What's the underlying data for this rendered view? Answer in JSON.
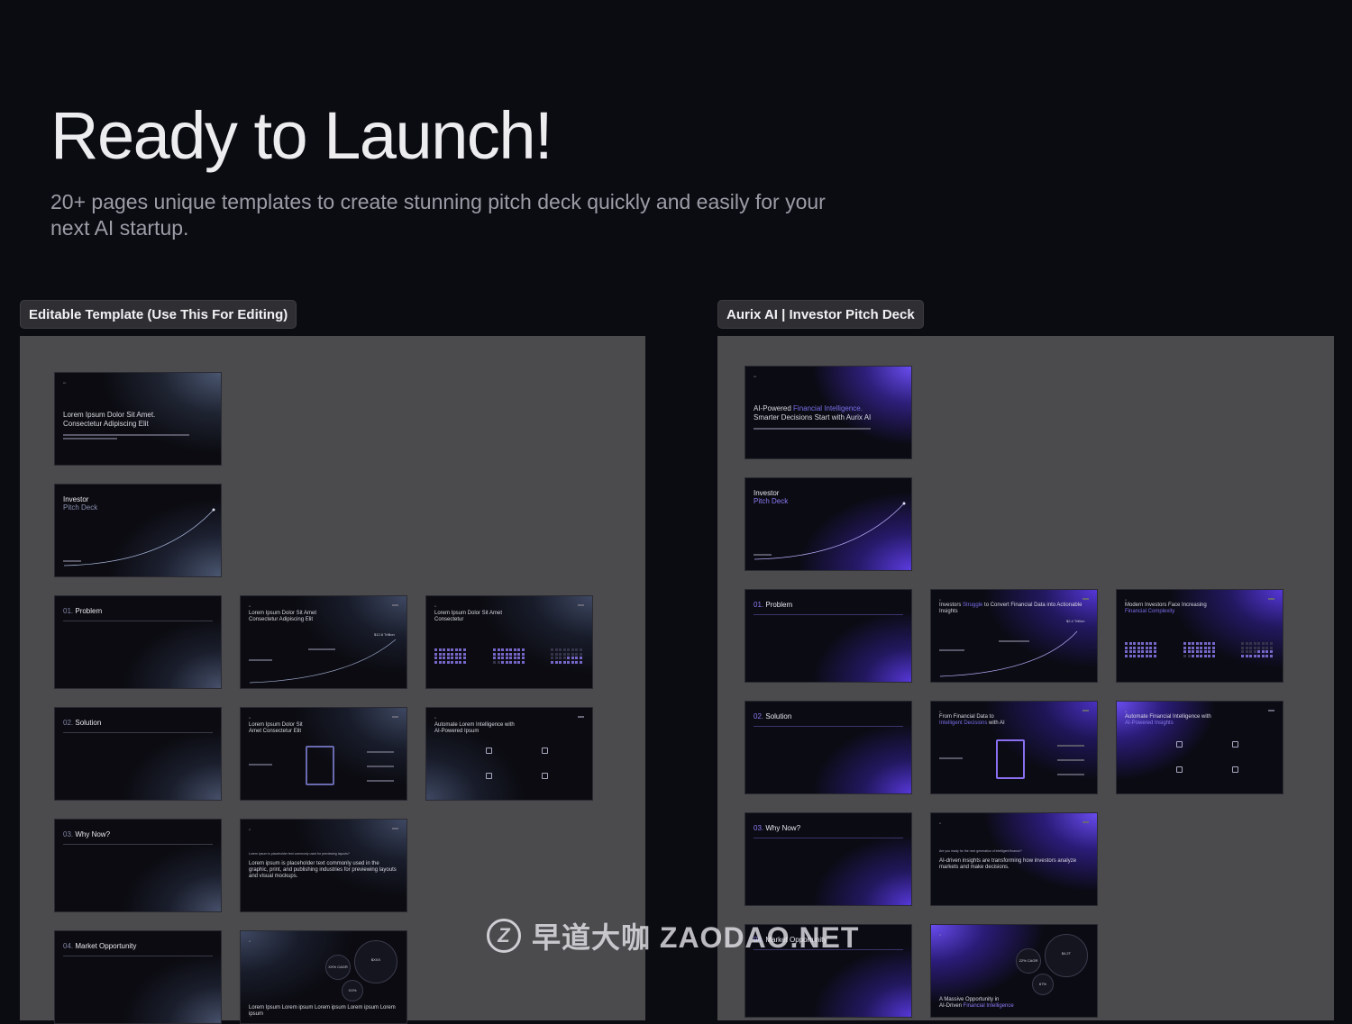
{
  "hero": {
    "title": "Ready to Launch!",
    "subtitle": "20+ pages unique templates to create stunning pitch deck quickly and easily for your next AI startup."
  },
  "frames": {
    "left_label": "Editable Template (Use This For Editing)",
    "right_label": "Aurix AI | Investor Pitch Deck"
  },
  "left": {
    "cover_title_1": "Lorem Ipsum Dolor Sit Amet.",
    "cover_title_2": "Consectetur Adipiscing Elit",
    "investor": "Investor",
    "pitch_deck": "Pitch Deck",
    "problem_num": "01.",
    "problem": "Problem",
    "problem_a_1": "Lorem Ipsum Dolor Sit Amet",
    "problem_a_2": "Consectetur Adipiscing Elit",
    "problem_a_value": "$12.8 Trillion",
    "problem_b_1": "Lorem Ipsum Dolor Sit Amet",
    "problem_b_2": "Consectetur",
    "solution_num": "02.",
    "solution": "Solution",
    "solution_a_1": "Lorem Ipsum Dolor Sit",
    "solution_a_2": "Amet Consectetur Elit",
    "solution_b_1": "Automate Lorem Intelligence with",
    "solution_b_2": "AI-Powered Ipsum",
    "why_num": "03.",
    "why": "Why Now?",
    "why_a_lead": "Lorem Ipsum is placeholder text commonly used for previewing layouts?",
    "why_a_body": "Lorem ipsum is placeholder text commonly used in the graphic, print, and publishing industries for previewing layouts and visual mockups.",
    "market_num": "04.",
    "market": "Market Opportunity",
    "market_a_body": "Lorem Ipsum Lorem ipsum Lorem ipsum Lorem ipsum Lorem ipsum",
    "market_cagr": "XX% CAGR",
    "market_value": "$XXX",
    "market_pct": "XX%"
  },
  "right": {
    "cover_plain_1": "AI-Powered ",
    "cover_accent": "Financial Intelligence.",
    "cover_plain_2": "Smarter Decisions Start with Aurix AI",
    "investor": "Investor",
    "pitch_deck": "Pitch Deck",
    "problem_num": "01.",
    "problem": "Problem",
    "problem_a_plain": "Investors ",
    "problem_a_accent": "Struggle",
    "problem_a_rest": " to Convert Financial Data into Actionable Insights",
    "problem_a_value": "$2.4 Trillion",
    "problem_b_plain": "Modern Investors Face Increasing",
    "problem_b_accent": "Financial Complexity",
    "solution_num": "02.",
    "solution": "Solution",
    "solution_a_plain": "From Financial Data to",
    "solution_a_accent": "Intelligent Decisions",
    "solution_a_rest": " with AI",
    "solution_b_plain": "Automate Financial Intelligence with",
    "solution_b_accent": "AI-Powered Insights",
    "why_num": "03.",
    "why": "Why Now?",
    "why_a_lead": "Are you ready for the next generation of intelligent finance?",
    "why_a_body": "AI-driven insights are transforming how investors analyze markets and make decisions.",
    "market_num": "04.",
    "market": "Market Opportunity",
    "market_a_plain": "A Massive Opportunity in",
    "market_a_plain_2": "AI-Driven ",
    "market_a_accent": "Financial Intelligence",
    "market_cagr": "22% CAGR",
    "market_value": "$4.2T",
    "market_pct": "67%"
  },
  "watermark": {
    "logo_letter": "Z",
    "text": "早道大咖  ZAODAO.NET"
  },
  "colors": {
    "background": "#0b0c12",
    "frame": "#4b4b4e",
    "accent": "#6a4cf0",
    "label_bg": "#2f2f33"
  }
}
